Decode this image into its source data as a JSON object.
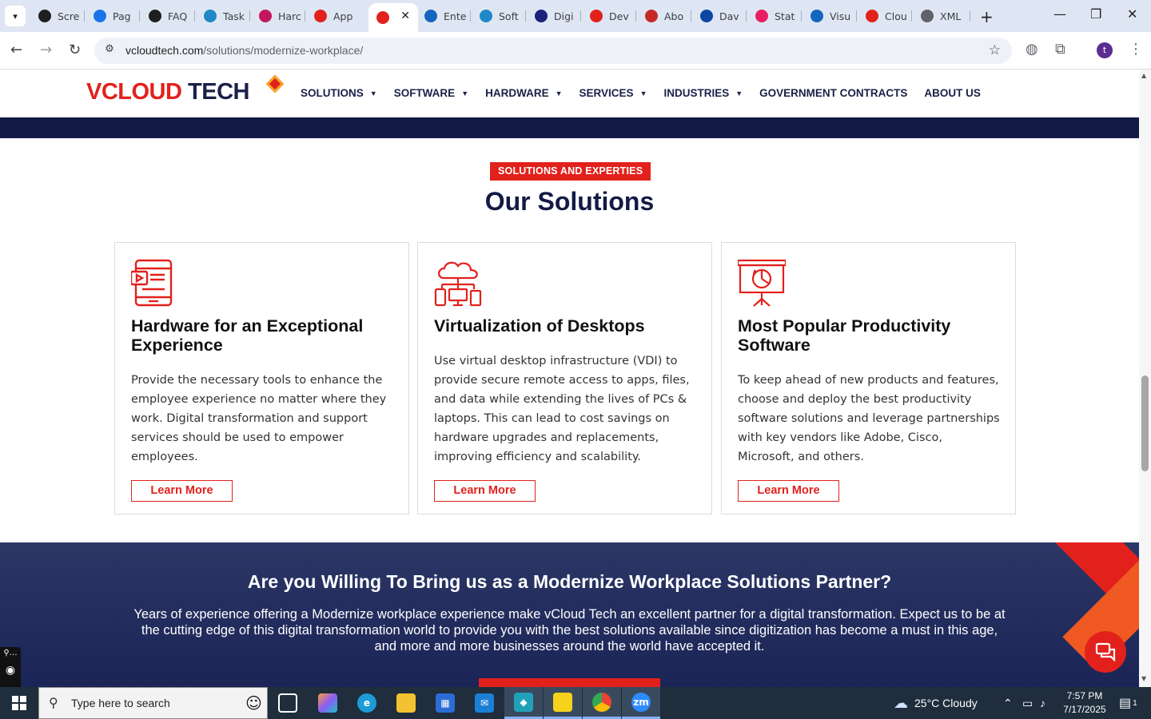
{
  "browser": {
    "tabs": [
      {
        "label": "Scre",
        "color": "#1f1f1f"
      },
      {
        "label": "Pag",
        "color": "#1a73e8"
      },
      {
        "label": "FAQ",
        "color": "#1f1f1f"
      },
      {
        "label": "Task",
        "color": "#1e88c8"
      },
      {
        "label": "Harc",
        "color": "#c2185b"
      },
      {
        "label": "App",
        "color": "#e2211c"
      },
      {
        "label": "",
        "color": "#e2211c"
      },
      {
        "label": "Ente",
        "color": "#1565c0"
      },
      {
        "label": "Soft",
        "color": "#1e88c8"
      },
      {
        "label": "Digi",
        "color": "#1a237e"
      },
      {
        "label": "Dev",
        "color": "#e2211c"
      },
      {
        "label": "Abo",
        "color": "#c62828"
      },
      {
        "label": "Dav",
        "color": "#0d47a1"
      },
      {
        "label": "Stat",
        "color": "#e91e63"
      },
      {
        "label": "Visu",
        "color": "#1565c0"
      },
      {
        "label": "Clou",
        "color": "#e2211c"
      },
      {
        "label": "XML",
        "color": "#5f6368"
      }
    ],
    "url_host": "vcloudtech.com",
    "url_path": "/solutions/modernize-workplace/",
    "profile_initial": "t"
  },
  "site": {
    "logo": {
      "v": "V",
      "cloud": "CLOUD",
      "tech": "TECH"
    },
    "nav": [
      {
        "label": "SOLUTIONS",
        "caret": true
      },
      {
        "label": "SOFTWARE",
        "caret": true
      },
      {
        "label": "HARDWARE",
        "caret": true
      },
      {
        "label": "SERVICES",
        "caret": true
      },
      {
        "label": "INDUSTRIES",
        "caret": true
      },
      {
        "label": "GOVERNMENT CONTRACTS",
        "caret": false
      },
      {
        "label": "ABOUT US",
        "caret": false
      }
    ]
  },
  "solutions": {
    "eyebrow": "SOLUTIONS AND EXPERTIES",
    "title": "Our Solutions",
    "cards": [
      {
        "icon": "tablet-video-icon",
        "title": "Hardware for an Exceptional Experience",
        "text": "Provide the necessary tools to enhance the employee experience no matter where they work. Digital transformation and support services should be used to empower employees.",
        "button": "Learn More"
      },
      {
        "icon": "cloud-network-icon",
        "title": "Virtualization of Desktops",
        "text": "Use virtual desktop infrastructure (VDI) to provide secure remote access to apps, files, and data while extending the lives of PCs & laptops. This can lead to cost savings on hardware upgrades and replacements, improving efficiency and scalability.",
        "button": "Learn More"
      },
      {
        "icon": "presentation-board-icon",
        "title": "Most Popular Productivity Software",
        "text": "To keep ahead of new products and features, choose and deploy the best productivity software solutions and leverage partnerships with key vendors like Adobe, Cisco, Microsoft, and others.",
        "button": "Learn More"
      }
    ]
  },
  "cta": {
    "title": "Are you Willing To Bring us as a Modernize Workplace Solutions Partner?",
    "text": "Years of experience offering a Modernize workplace experience make vCloud Tech an excellent partner for a digital transformation. Expect us to be at the cutting edge of this digital transformation world to provide you with the best solutions available since digitization has become a must in this age, and more and more businesses around the world have accepted it."
  },
  "taskbar": {
    "search_placeholder": "Type here to search",
    "weather": "25°C  Cloudy",
    "time": "7:57 PM",
    "date": "7/17/2025",
    "notifications": "1"
  },
  "colors": {
    "brand_red": "#e2211c",
    "brand_navy": "#121a45"
  }
}
